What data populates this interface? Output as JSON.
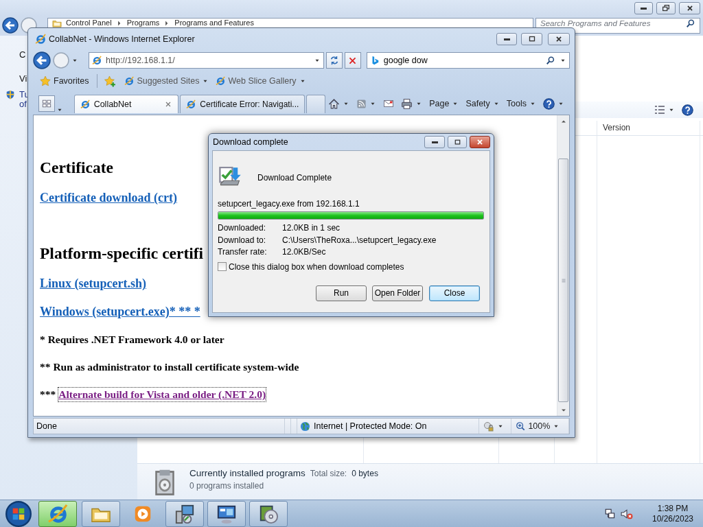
{
  "control_panel": {
    "address": [
      {
        "text": "Control Panel"
      },
      {
        "text": "Programs"
      },
      {
        "text": "Programs and Features"
      }
    ],
    "search": {
      "placeholder": "Search Programs and Features"
    },
    "left_pane": [
      {
        "kind": "text",
        "text": "C"
      },
      {
        "kind": "text",
        "text": "Vi"
      },
      {
        "kind": "shield-link",
        "text": "Tu"
      },
      {
        "kind": "link",
        "text": "of"
      }
    ],
    "column_header": "Version",
    "details": {
      "title": "Currently installed programs",
      "size_label": "Total size:",
      "size_value": "0 bytes",
      "count": "0 programs installed"
    }
  },
  "browser": {
    "title": "CollabNet - Windows Internet Explorer",
    "address": "http://192.168.1.1/",
    "search": {
      "value": "google dow"
    },
    "favorites_button": "Favorites",
    "favorite_links": [
      "Suggested Sites",
      "Web Slice Gallery"
    ],
    "tabs": [
      {
        "label": "CollabNet",
        "selected": true
      },
      {
        "label": "Certificate Error: Navigati...",
        "selected": false
      }
    ],
    "command_menus": [
      "Page",
      "Safety",
      "Tools"
    ],
    "page": {
      "blocks": [
        {
          "kind": "heading",
          "text": "Certificate"
        },
        {
          "kind": "link",
          "text": "Certificate download (crt)"
        },
        {
          "kind": "heading",
          "text": "Platform-specific certifi"
        },
        {
          "kind": "link",
          "text": "Linux (setupcert.sh)"
        },
        {
          "kind": "link",
          "text": "Windows (setupcert.exe)* ** *"
        },
        {
          "kind": "note",
          "text": "* Requires .NET Framework 4.0 or later"
        },
        {
          "kind": "note",
          "text": "** Run as administrator to install certificate system-wide"
        },
        {
          "kind": "note-link",
          "text": "***",
          "link": "Alternate build for Vista and older (.NET 2.0)",
          "visited": true
        }
      ]
    },
    "status": {
      "text": "Done",
      "zone": "Internet | Protected Mode: On",
      "zoom": "100%"
    }
  },
  "dialog": {
    "title": "Download complete",
    "heading": "Download Complete",
    "source": "setupcert_legacy.exe from 192.168.1.1",
    "progress": {
      "level": 1
    },
    "details": [
      {
        "label": "Downloaded:",
        "value": "12.0KB in 1 sec"
      },
      {
        "label": "Download to:",
        "value": "C:\\Users\\TheRoxa...\\setupcert_legacy.exe"
      },
      {
        "label": "Transfer rate:",
        "value": "12.0KB/Sec"
      }
    ],
    "close_when_done": {
      "label": "Close this dialog box when download completes",
      "checked": false
    },
    "buttons": [
      {
        "label": "Run",
        "default": false
      },
      {
        "label": "Open Folder",
        "default": false
      },
      {
        "label": "Close",
        "default": true
      }
    ]
  },
  "taskbar": {
    "apps": [
      {
        "kind": "ie",
        "selected": true,
        "running": true
      },
      {
        "kind": "explorer",
        "selected": false,
        "running": true
      },
      {
        "kind": "media",
        "selected": false,
        "running": false
      },
      {
        "kind": "setup",
        "selected": false,
        "running": true
      },
      {
        "kind": "control-panel",
        "selected": false,
        "running": true
      },
      {
        "kind": "disc",
        "selected": false,
        "running": true
      }
    ],
    "time": "1:38 PM",
    "date": "10/26/2023"
  }
}
